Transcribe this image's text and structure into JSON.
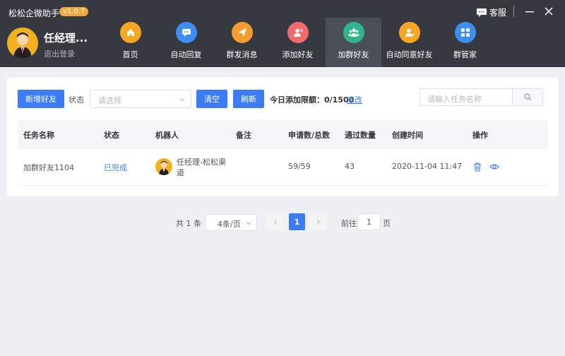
{
  "app": {
    "title": "松松企微助手",
    "version": "v1.0.7"
  },
  "user": {
    "name": "任经理...",
    "logout": "退出登录"
  },
  "nav": [
    {
      "label": "首页",
      "icon": "home-icon",
      "color": "#f5a623"
    },
    {
      "label": "自动回复",
      "icon": "chat-icon",
      "color": "#3d8ef0"
    },
    {
      "label": "群发消息",
      "icon": "send-icon",
      "color": "#f39c2f"
    },
    {
      "label": "添加好友",
      "icon": "add-user-icon",
      "color": "#f06b6b"
    },
    {
      "label": "加群好友",
      "icon": "group-icon",
      "color": "#2fb68a",
      "active": true
    },
    {
      "label": "自动同意好友",
      "icon": "user-check-icon",
      "color": "#f5a623"
    },
    {
      "label": "群管家",
      "icon": "grid-icon",
      "color": "#3d8ef0"
    }
  ],
  "window": {
    "service": "客服"
  },
  "toolbar": {
    "add_friend": "新增好友",
    "status_label": "状态",
    "status_placeholder": "请选择",
    "clear": "清空",
    "refresh": "刷新",
    "limit_label": "今日添加限额：",
    "limit_value": "0/1500",
    "edit": "修改",
    "search_placeholder": "请输入任务名称"
  },
  "table": {
    "headers": [
      "任务名称",
      "状态",
      "机器人",
      "备注",
      "申请数/总数",
      "通过数量",
      "创建时间",
      "操作"
    ],
    "rows": [
      {
        "task": "加群好友1104",
        "status": "已完成",
        "bot": "任经理-松松渠道",
        "note": "",
        "applied": "59/59",
        "passed": "43",
        "created": "2020-11-04 11:47"
      }
    ]
  },
  "pagination": {
    "total": "共 1 条",
    "page_size": "4条/页",
    "current": "1",
    "goto_label": "前往",
    "goto_value": "1",
    "goto_suffix": "页"
  },
  "colors": {
    "primary": "#3c7cf5",
    "header_bg": "#363940",
    "badge": "#f3a93a"
  }
}
